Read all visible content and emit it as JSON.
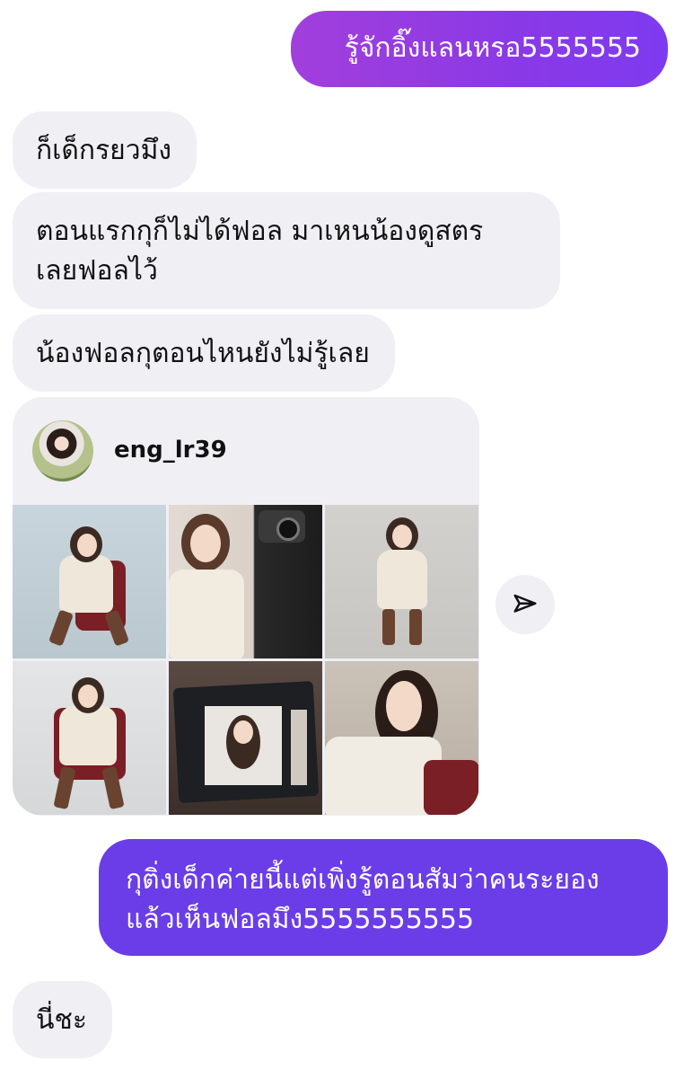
{
  "messages": [
    {
      "id": "b1",
      "direction": "out",
      "text": "รู้จักอิ๊งแลนหรอ5555555"
    },
    {
      "id": "b2",
      "direction": "in",
      "text": "ก็เด็กรยวมึง"
    },
    {
      "id": "b3",
      "direction": "in",
      "lines": [
        "ตอนแรกกุก็ไม่ได้ฟอล มาเหนน้องดูสตร",
        "เลยฟอลไว้"
      ]
    },
    {
      "id": "b4",
      "direction": "in",
      "text": "น้องฟอลกุตอนไหนยังไม่รู้เลย"
    },
    {
      "id": "b5",
      "direction": "out",
      "lines": [
        "กุติ่งเด็กค่ายนี้แต่เพิ่งรู้ตอนสัมว่าคนระยอง",
        "แล้วเห็นฟอลมึง5555555555"
      ]
    },
    {
      "id": "b6",
      "direction": "in",
      "text": "นี่ชะ"
    }
  ],
  "shared_profile": {
    "username": "eng_lr39",
    "photos": [
      "photo-sitting-red-chair",
      "photo-portrait-with-camera",
      "photo-standing-grey-backdrop",
      "photo-sitting-red-chair-2",
      "photo-laptop-editing",
      "photo-closeup-reclining"
    ]
  },
  "icons": {
    "share": "paper-plane-icon"
  },
  "colors": {
    "outgoing_gradient_start": "#a23fdc",
    "outgoing_gradient_end": "#7e3af0",
    "outgoing_solid": "#6a3de8",
    "incoming_bg": "#efeff4"
  }
}
